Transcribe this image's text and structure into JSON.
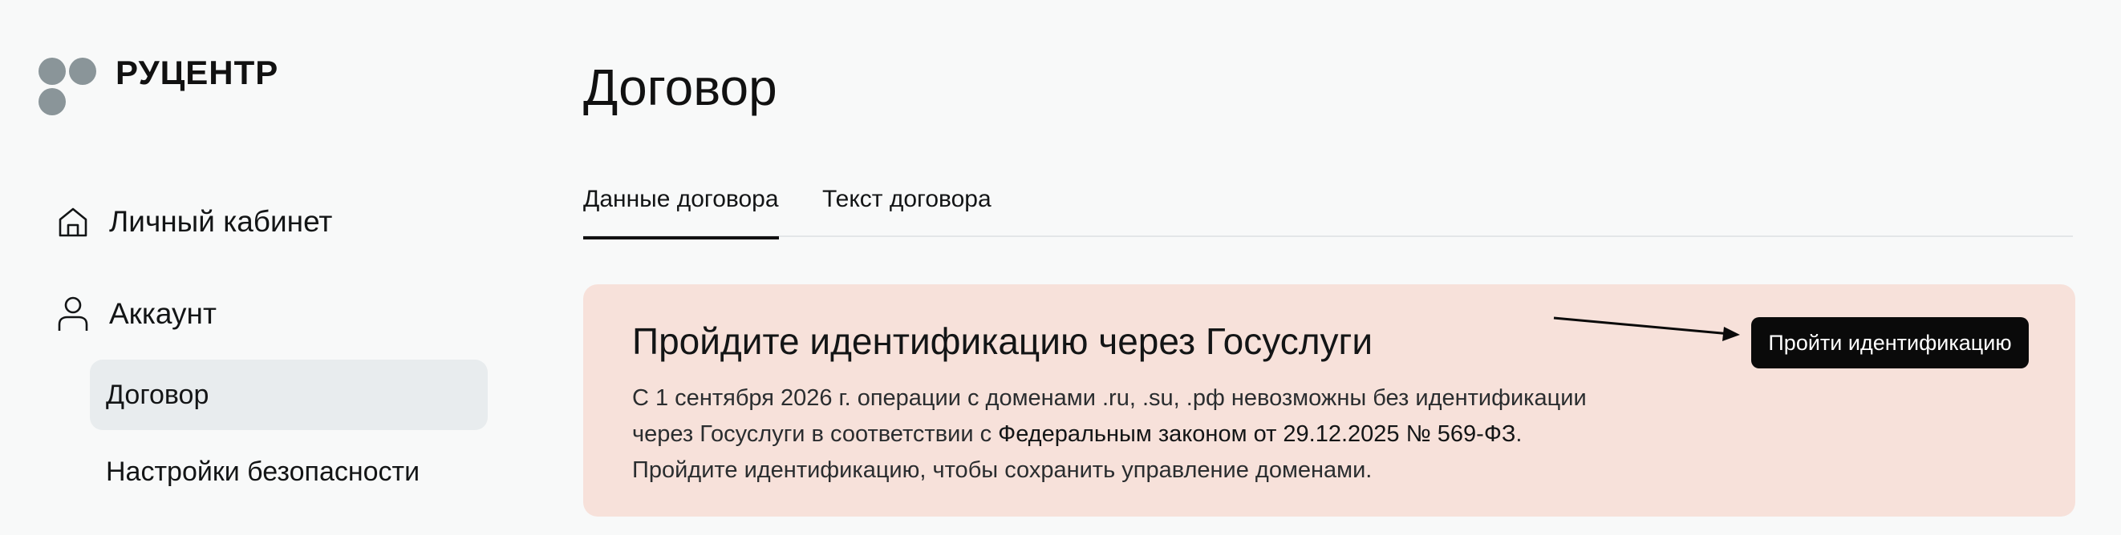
{
  "brand": {
    "name": "РУЦЕНТР"
  },
  "sidebar": {
    "items": [
      {
        "label": "Личный кабинет",
        "icon": "home-icon"
      },
      {
        "label": "Аккаунт",
        "icon": "user-icon"
      }
    ],
    "sub_items": [
      {
        "label": "Договор",
        "active": true
      },
      {
        "label": "Настройки безопасности",
        "active": false
      }
    ]
  },
  "main": {
    "title": "Договор",
    "tabs": [
      {
        "label": "Данные договора",
        "active": true
      },
      {
        "label": "Текст договора",
        "active": false
      }
    ],
    "banner": {
      "title": "Пройдите идентификацию через Госуслуги",
      "text_line1": "С 1 сентября 2026 г. операции с доменами .ru, .su, .рф невозможны без идентификации",
      "text_line2_prefix": "через Госуслуги в соответствии с ",
      "law_link": "Федеральным законом от 29.12.2025 № 569-ФЗ",
      "text_line2_suffix": ".",
      "text_line3": "Пройдите идентификацию, чтобы сохранить управление доменами.",
      "button_label": "Пройти идентификацию",
      "background": "#f7e1da"
    }
  },
  "colors": {
    "page_bg": "#f8f9f9",
    "logo_dots": "#8a9599",
    "active_nav_bg": "#e8ecee",
    "button_bg": "#0a0a0a"
  }
}
